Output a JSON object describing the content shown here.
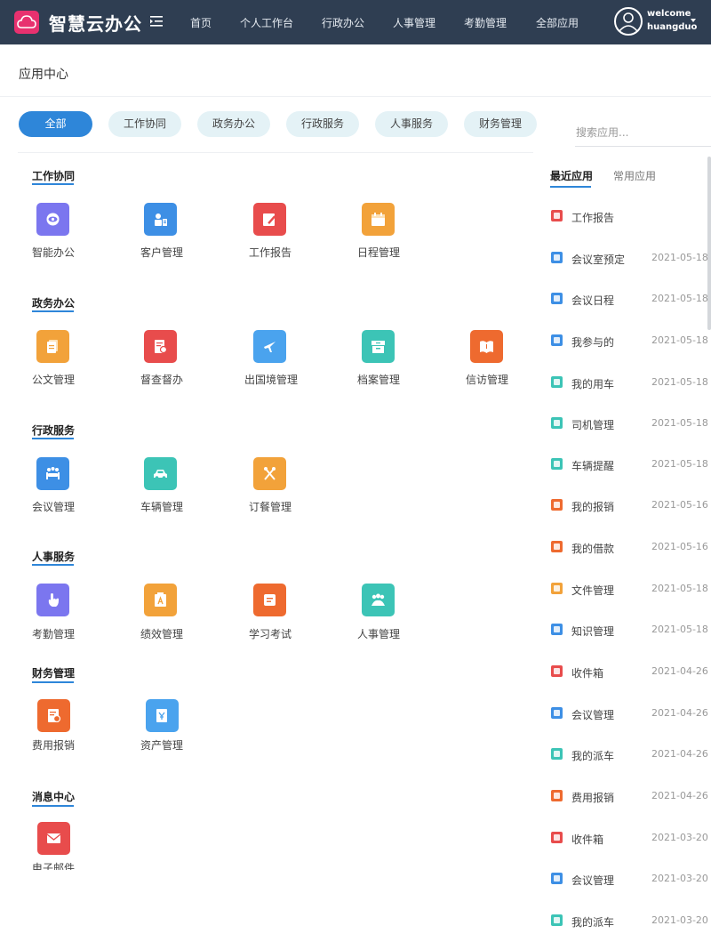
{
  "header": {
    "app_title": "智慧云办公",
    "nav": [
      "首页",
      "个人工作台",
      "行政办公",
      "人事管理",
      "考勤管理",
      "全部应用"
    ],
    "user": {
      "welcome": "welcome",
      "name": "huangduo"
    }
  },
  "page": {
    "title": "应用中心"
  },
  "filters": {
    "tabs": [
      "全部",
      "工作协同",
      "政务办公",
      "行政服务",
      "人事服务",
      "财务管理"
    ],
    "active": "全部",
    "search_placeholder": "搜索应用..."
  },
  "sections": [
    {
      "title": "工作协同",
      "apps": [
        {
          "label": "智能办公",
          "color": "#7b76ef",
          "icon": "eye-icon"
        },
        {
          "label": "客户管理",
          "color": "#3d8fe5",
          "icon": "id-card-icon"
        },
        {
          "label": "工作报告",
          "color": "#e84c4c",
          "icon": "pen-icon"
        },
        {
          "label": "日程管理",
          "color": "#f2a23a",
          "icon": "calendar-icon"
        }
      ]
    },
    {
      "title": "政务办公",
      "apps": [
        {
          "label": "公文管理",
          "color": "#f2a23a",
          "icon": "document-icon"
        },
        {
          "label": "督查督办",
          "color": "#e84c4c",
          "icon": "inspect-icon"
        },
        {
          "label": "出国境管理",
          "color": "#4aa3ee",
          "icon": "plane-icon"
        },
        {
          "label": "档案管理",
          "color": "#3cc4b6",
          "icon": "archive-icon"
        },
        {
          "label": "信访管理",
          "color": "#ee6a2f",
          "icon": "book-icon"
        }
      ]
    },
    {
      "title": "行政服务",
      "apps": [
        {
          "label": "会议管理",
          "color": "#3d8fe5",
          "icon": "meeting-icon"
        },
        {
          "label": "车辆管理",
          "color": "#3cc4b6",
          "icon": "car-icon"
        },
        {
          "label": "订餐管理",
          "color": "#f2a23a",
          "icon": "fork-knife-icon"
        }
      ]
    },
    {
      "title": "人事服务",
      "apps": [
        {
          "label": "考勤管理",
          "color": "#7b76ef",
          "icon": "hand-icon"
        },
        {
          "label": "绩效管理",
          "color": "#f2a23a",
          "icon": "clipboard-icon"
        },
        {
          "label": "学习考试",
          "color": "#ee6a2f",
          "icon": "exam-icon"
        },
        {
          "label": "人事管理",
          "color": "#3cc4b6",
          "icon": "people-icon"
        }
      ]
    },
    {
      "title": "财务管理",
      "apps": [
        {
          "label": "费用报销",
          "color": "#ee6a2f",
          "icon": "receipt-icon"
        },
        {
          "label": "资产管理",
          "color": "#4aa3ee",
          "icon": "asset-icon"
        }
      ]
    },
    {
      "title": "消息中心",
      "apps": [
        {
          "label": "电子邮件",
          "color": "#e84c4c",
          "icon": "mail-icon"
        }
      ]
    }
  ],
  "recent_panel": {
    "tabs": [
      "最近应用",
      "常用应用"
    ],
    "active": "最近应用",
    "items": [
      {
        "name": "工作报告",
        "date": "",
        "color": "#e84c4c"
      },
      {
        "name": "会议室预定",
        "date": "2021-05-18",
        "color": "#3d8fe5"
      },
      {
        "name": "会议日程",
        "date": "2021-05-18",
        "color": "#3d8fe5"
      },
      {
        "name": "我参与的",
        "date": "2021-05-18",
        "color": "#3d8fe5"
      },
      {
        "name": "我的用车",
        "date": "2021-05-18",
        "color": "#3cc4b6"
      },
      {
        "name": "司机管理",
        "date": "2021-05-18",
        "color": "#3cc4b6"
      },
      {
        "name": "车辆提醒",
        "date": "2021-05-18",
        "color": "#3cc4b6"
      },
      {
        "name": "我的报销",
        "date": "2021-05-16",
        "color": "#ee6a2f"
      },
      {
        "name": "我的借款",
        "date": "2021-05-16",
        "color": "#ee6a2f"
      },
      {
        "name": "文件管理",
        "date": "2021-05-18",
        "color": "#f2a23a"
      },
      {
        "name": "知识管理",
        "date": "2021-05-18",
        "color": "#3d8fe5"
      },
      {
        "name": "收件箱",
        "date": "2021-04-26",
        "color": "#e84c4c"
      },
      {
        "name": "会议管理",
        "date": "2021-04-26",
        "color": "#3d8fe5"
      },
      {
        "name": "我的派车",
        "date": "2021-04-26",
        "color": "#3cc4b6"
      },
      {
        "name": "费用报销",
        "date": "2021-04-26",
        "color": "#ee6a2f"
      },
      {
        "name": "收件箱",
        "date": "2021-03-20",
        "color": "#e84c4c"
      },
      {
        "name": "会议管理",
        "date": "2021-03-20",
        "color": "#3d8fe5"
      },
      {
        "name": "我的派车",
        "date": "2021-03-20",
        "color": "#3cc4b6"
      }
    ]
  }
}
